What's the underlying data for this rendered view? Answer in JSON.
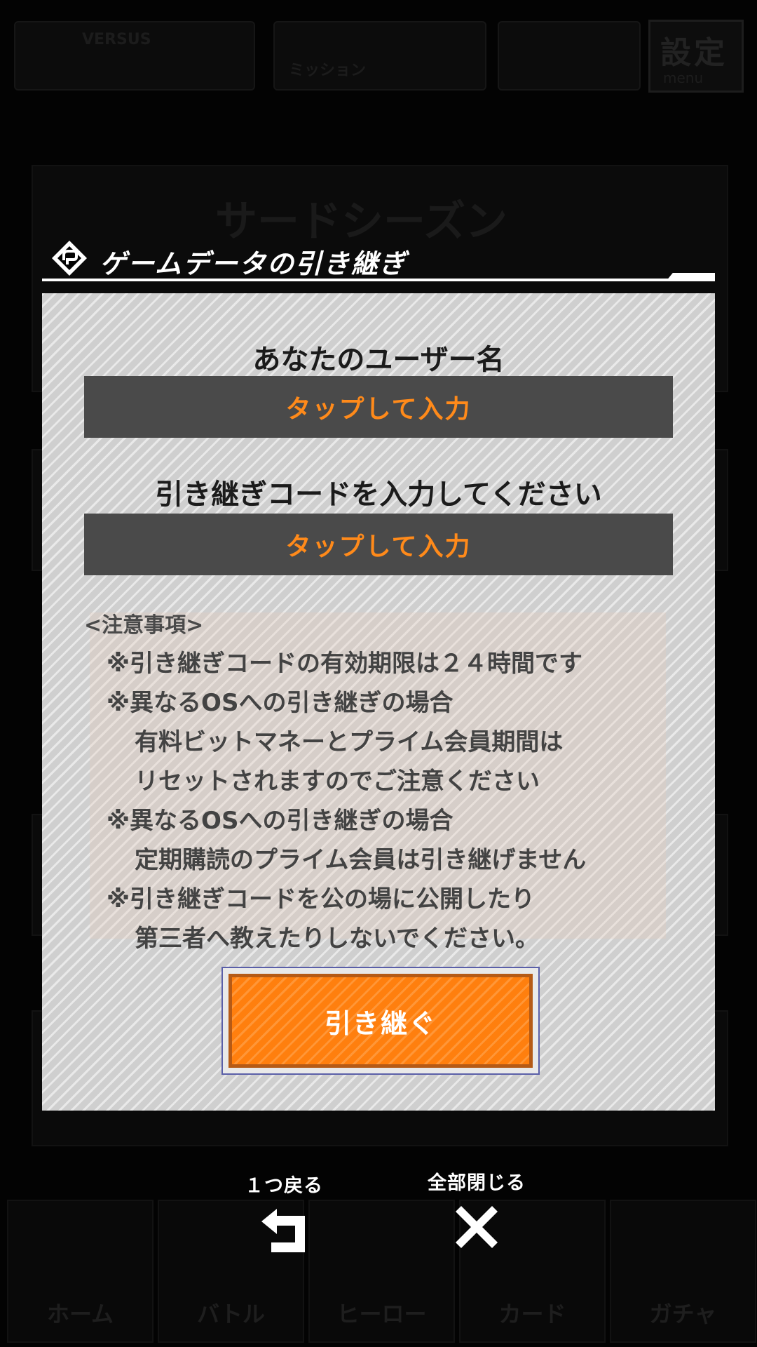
{
  "background": {
    "top_bar": [
      "VERSUS",
      "ミッション",
      "設定",
      "menu"
    ],
    "banner_text": "サードシーズン",
    "nav": [
      "ホーム",
      "バトル",
      "ヒーロー",
      "カード",
      "ガチャ"
    ]
  },
  "dialog": {
    "title": "ゲームデータの引き継ぎ",
    "username_label": "あなたのユーザー名",
    "username_input": "タップして入力",
    "code_label": "引き継ぎコードを入力してください",
    "code_input": "タップして入力",
    "notes_heading": "<注意事項>",
    "notes": [
      "※引き継ぎコードの有効期限は２４時間です",
      "※異なるOSへの引き継ぎの場合",
      "有料ビットマネーとプライム会員期間は",
      "リセットされますのでご注意ください",
      "※異なるOSへの引き継ぎの場合",
      "定期購読のプライム会員は引き継げません",
      "※引き継ぎコードを公の場に公開したり",
      "第三者へ教えたりしないでください。"
    ],
    "submit_label": "引き継ぐ"
  },
  "controls": {
    "back_label": "１つ戻る",
    "close_all_label": "全部閉じる"
  },
  "colors": {
    "accent": "#ff7f0e",
    "input_text": "#ff8a1a",
    "input_bg": "#4a4a4a",
    "panel": "#cfcfcf"
  },
  "icons": [
    "app-logo-icon",
    "back-arrow-icon",
    "close-x-icon"
  ]
}
